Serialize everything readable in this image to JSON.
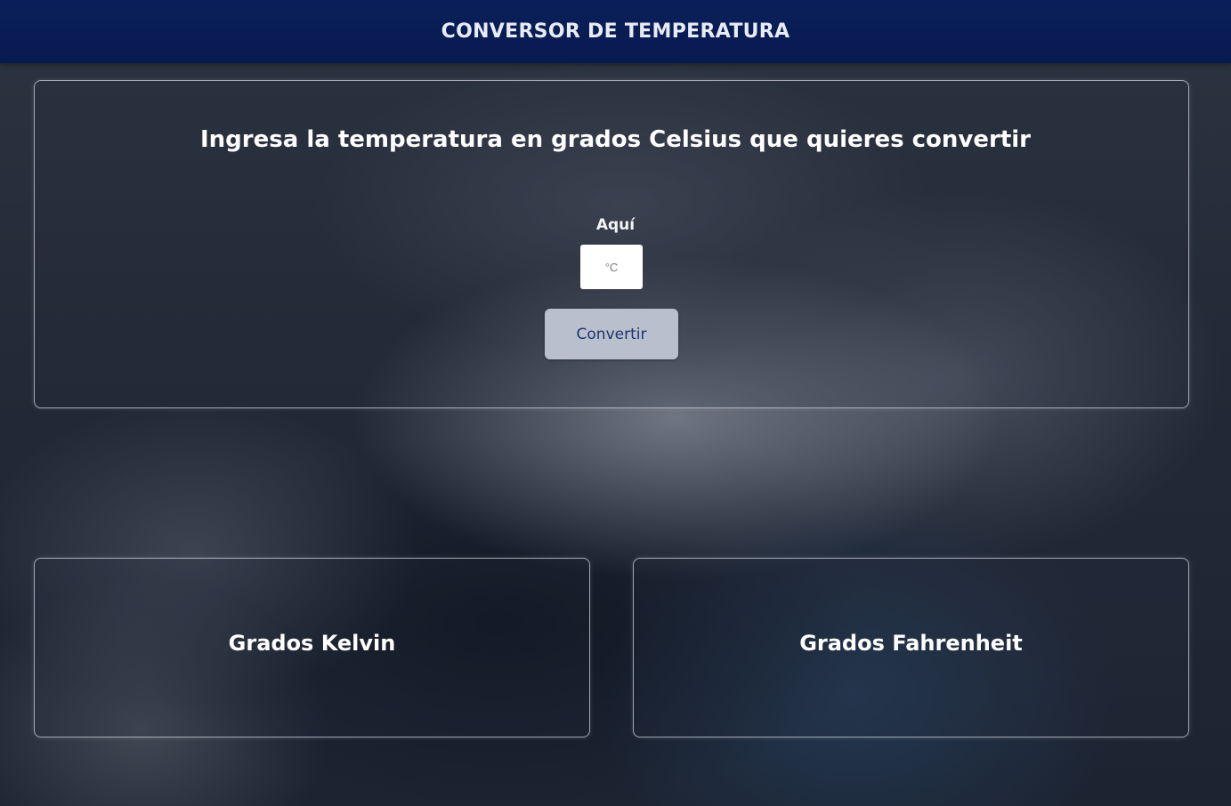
{
  "header": {
    "title": "CONVERSOR DE TEMPERATURA"
  },
  "converter": {
    "heading": "Ingresa la temperatura en grados Celsius que quieres convertir",
    "field_label": "Aquí",
    "input_value": "",
    "input_placeholder": "°C",
    "convert_label": "Convertir"
  },
  "results": {
    "kelvin_title": "Grados Kelvin",
    "fahrenheit_title": "Grados Fahrenheit"
  },
  "colors": {
    "header_bg": "#0a1f5a",
    "button_bg": "#b9bfcc",
    "button_text": "#1c3470",
    "panel_border": "#cdd2de"
  }
}
